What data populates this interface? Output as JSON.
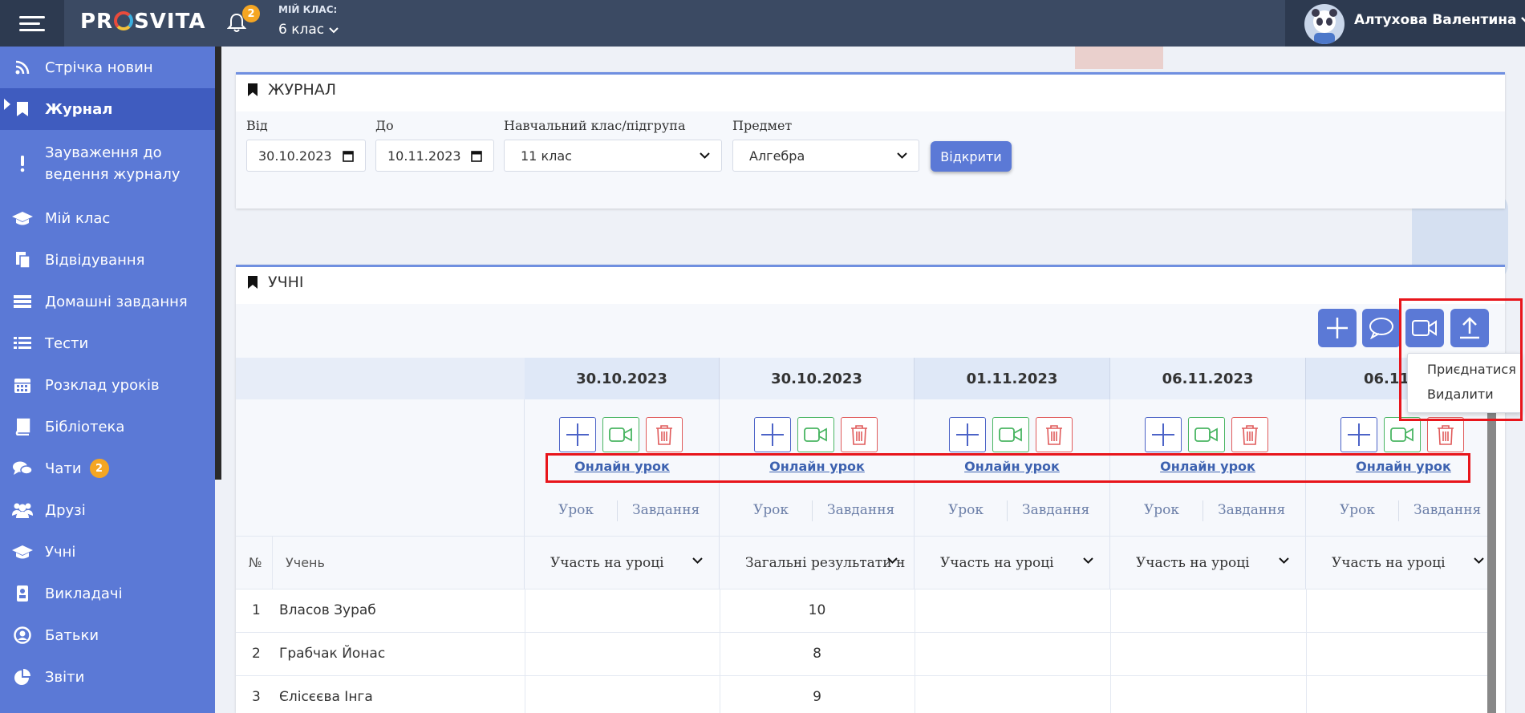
{
  "topbar": {
    "logo": "PROSVITA",
    "notifications_count": "2",
    "my_class_label": "МІЙ КЛАС:",
    "my_class_value": "6 клас",
    "user_name": "Алтухова Валентина"
  },
  "sidebar": {
    "items": [
      {
        "label": "Стрічка новин",
        "icon": "rss-icon"
      },
      {
        "label": "Журнал",
        "icon": "bookmark-icon"
      },
      {
        "label": "Зауваження до ведення журналу",
        "icon": "exclamation-icon"
      },
      {
        "label": "Мій клас",
        "icon": "graduation-cap-icon"
      },
      {
        "label": "Відвідування",
        "icon": "documents-icon"
      },
      {
        "label": "Домашні завдання",
        "icon": "tasks-icon"
      },
      {
        "label": "Тести",
        "icon": "list-icon"
      },
      {
        "label": "Розклад уроків",
        "icon": "calendar-icon"
      },
      {
        "label": "Бібліотека",
        "icon": "book-icon"
      },
      {
        "label": "Чати",
        "icon": "chat-icon",
        "badge": "2"
      },
      {
        "label": "Друзі",
        "icon": "users-icon"
      },
      {
        "label": "Учні",
        "icon": "graduation-cap-icon"
      },
      {
        "label": "Викладачі",
        "icon": "teacher-icon"
      },
      {
        "label": "Батьки",
        "icon": "user-circle-icon"
      },
      {
        "label": "Звіти",
        "icon": "pie-chart-icon"
      }
    ]
  },
  "journal": {
    "title": "ЖУРНАЛ",
    "from_label": "Від",
    "from_value": "30.10.2023",
    "to_label": "До",
    "to_value": "10.11.2023",
    "class_label": "Навчальний клас/підгрупа",
    "class_value": "11 клас",
    "subject_label": "Предмет",
    "subject_value": "Алгебра",
    "open_button": "Відкрити"
  },
  "students": {
    "title": "УЧНІ",
    "dropdown": [
      "Приєднатися",
      "Видалити"
    ],
    "columns": [
      {
        "date": "30.10.2023",
        "link": "Онлайн урок",
        "lesson": "Урок",
        "task": "Завдання",
        "select": "Участь на уроці"
      },
      {
        "date": "30.10.2023",
        "link": "Онлайн урок",
        "lesson": "Урок",
        "task": "Завдання",
        "select": "Загальні результати н"
      },
      {
        "date": "01.11.2023",
        "link": "Онлайн урок",
        "lesson": "Урок",
        "task": "Завдання",
        "select": "Участь на уроці"
      },
      {
        "date": "06.11.2023",
        "link": "Онлайн урок",
        "lesson": "Урок",
        "task": "Завдання",
        "select": "Участь на уроці"
      },
      {
        "date": "06.11.",
        "link": "Онлайн урок",
        "lesson": "Урок",
        "task": "Завдання",
        "select": "Участь на уроці"
      }
    ],
    "num_header": "№",
    "name_header": "Учень",
    "rows": [
      {
        "n": "1",
        "name": "Власов Зураб",
        "values": [
          "",
          "10",
          "",
          "",
          ""
        ]
      },
      {
        "n": "2",
        "name": "Грабчак Йонас",
        "values": [
          "",
          "8",
          "",
          "",
          ""
        ]
      },
      {
        "n": "3",
        "name": "Єлісєєва Інга",
        "values": [
          "",
          "9",
          "",
          "",
          ""
        ]
      }
    ]
  },
  "colors": {
    "sidebar": "#5b79d6",
    "topbar": "#3b4a63",
    "accent": "#5b79d6",
    "highlight": "#e8151b"
  }
}
